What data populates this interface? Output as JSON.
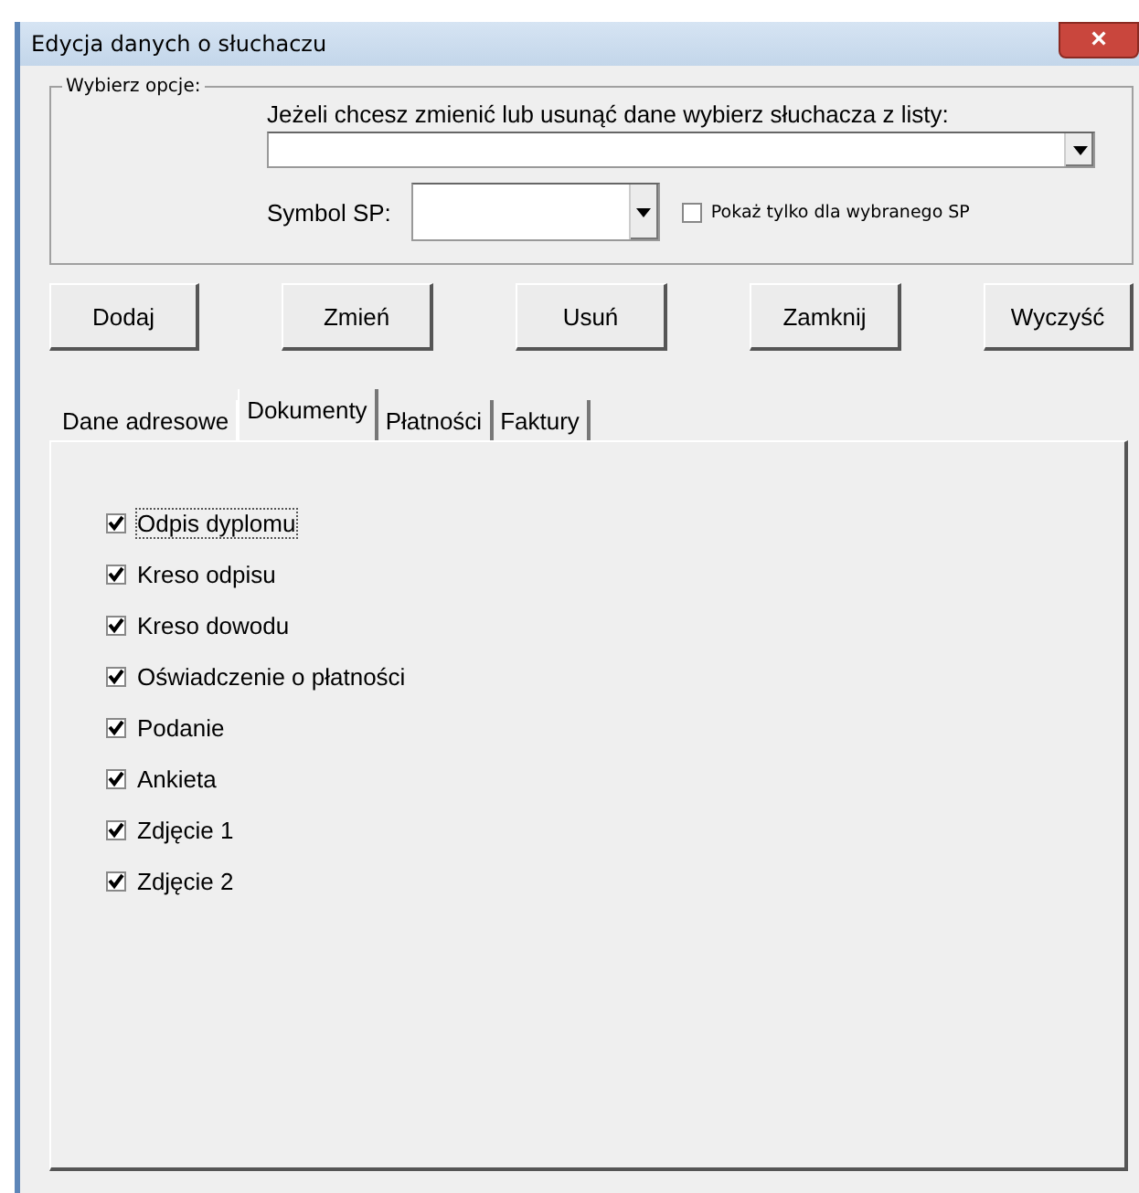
{
  "window": {
    "title": "Edycja danych o słuchaczu",
    "close_label": "×"
  },
  "group": {
    "title": "Wybierz opcje:",
    "prompt": "Jeżeli chcesz zmienić lub usunąć dane wybierz słuchacza z listy:",
    "symbol_label": "Symbol SP:",
    "filter": {
      "label": "Pokaż tylko dla wybranego SP",
      "checked": false
    }
  },
  "buttons": [
    "Dodaj",
    "Zmień",
    "Usuń",
    "Zamknij",
    "Wyczyść"
  ],
  "tabs": [
    {
      "label": "Dane adresowe",
      "selected": false
    },
    {
      "label": "Dokumenty",
      "selected": true
    },
    {
      "label": "Płatności",
      "selected": false
    },
    {
      "label": "Faktury",
      "selected": false
    }
  ],
  "documents": [
    {
      "label": "Odpis dyplomu",
      "checked": true
    },
    {
      "label": "Kreso odpisu",
      "checked": true
    },
    {
      "label": "Kreso dowodu",
      "checked": true
    },
    {
      "label": "Oświadczenie o płatności",
      "checked": true
    },
    {
      "label": "Podanie",
      "checked": true
    },
    {
      "label": "Ankieta",
      "checked": true
    },
    {
      "label": "Zdjęcie 1",
      "checked": true
    },
    {
      "label": "Zdjęcie 2",
      "checked": true
    }
  ]
}
